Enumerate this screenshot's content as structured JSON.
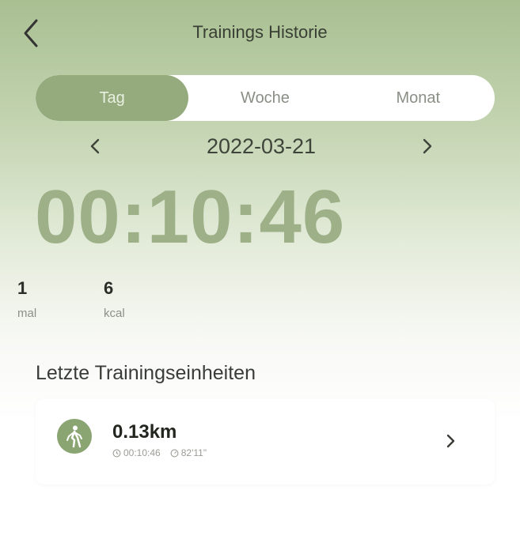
{
  "header": {
    "title": "Trainings Historie",
    "back_icon": "chevron-left-icon"
  },
  "tabs": [
    {
      "label": "Tag",
      "active": true
    },
    {
      "label": "Woche",
      "active": false
    },
    {
      "label": "Monat",
      "active": false
    }
  ],
  "date": {
    "value": "2022-03-21",
    "prev_icon": "chevron-left-icon",
    "next_icon": "chevron-right-icon"
  },
  "summary": {
    "duration": "00:10:46",
    "count_value": "1",
    "count_unit": "mal",
    "calories_value": "6",
    "calories_unit": "kcal"
  },
  "recent": {
    "title": "Letzte Trainingseinheiten",
    "items": [
      {
        "icon": "walking-icon",
        "distance": "0.13km",
        "duration": "00:10:46",
        "pace": "82'11\"",
        "arrow_icon": "chevron-right-icon"
      }
    ]
  },
  "colors": {
    "accent": "#95ab7e",
    "accent_dark": "#8aa572",
    "big_number": "#9db087",
    "header_bg_top": "#a9bf92",
    "card_bg": "#ffffff"
  }
}
